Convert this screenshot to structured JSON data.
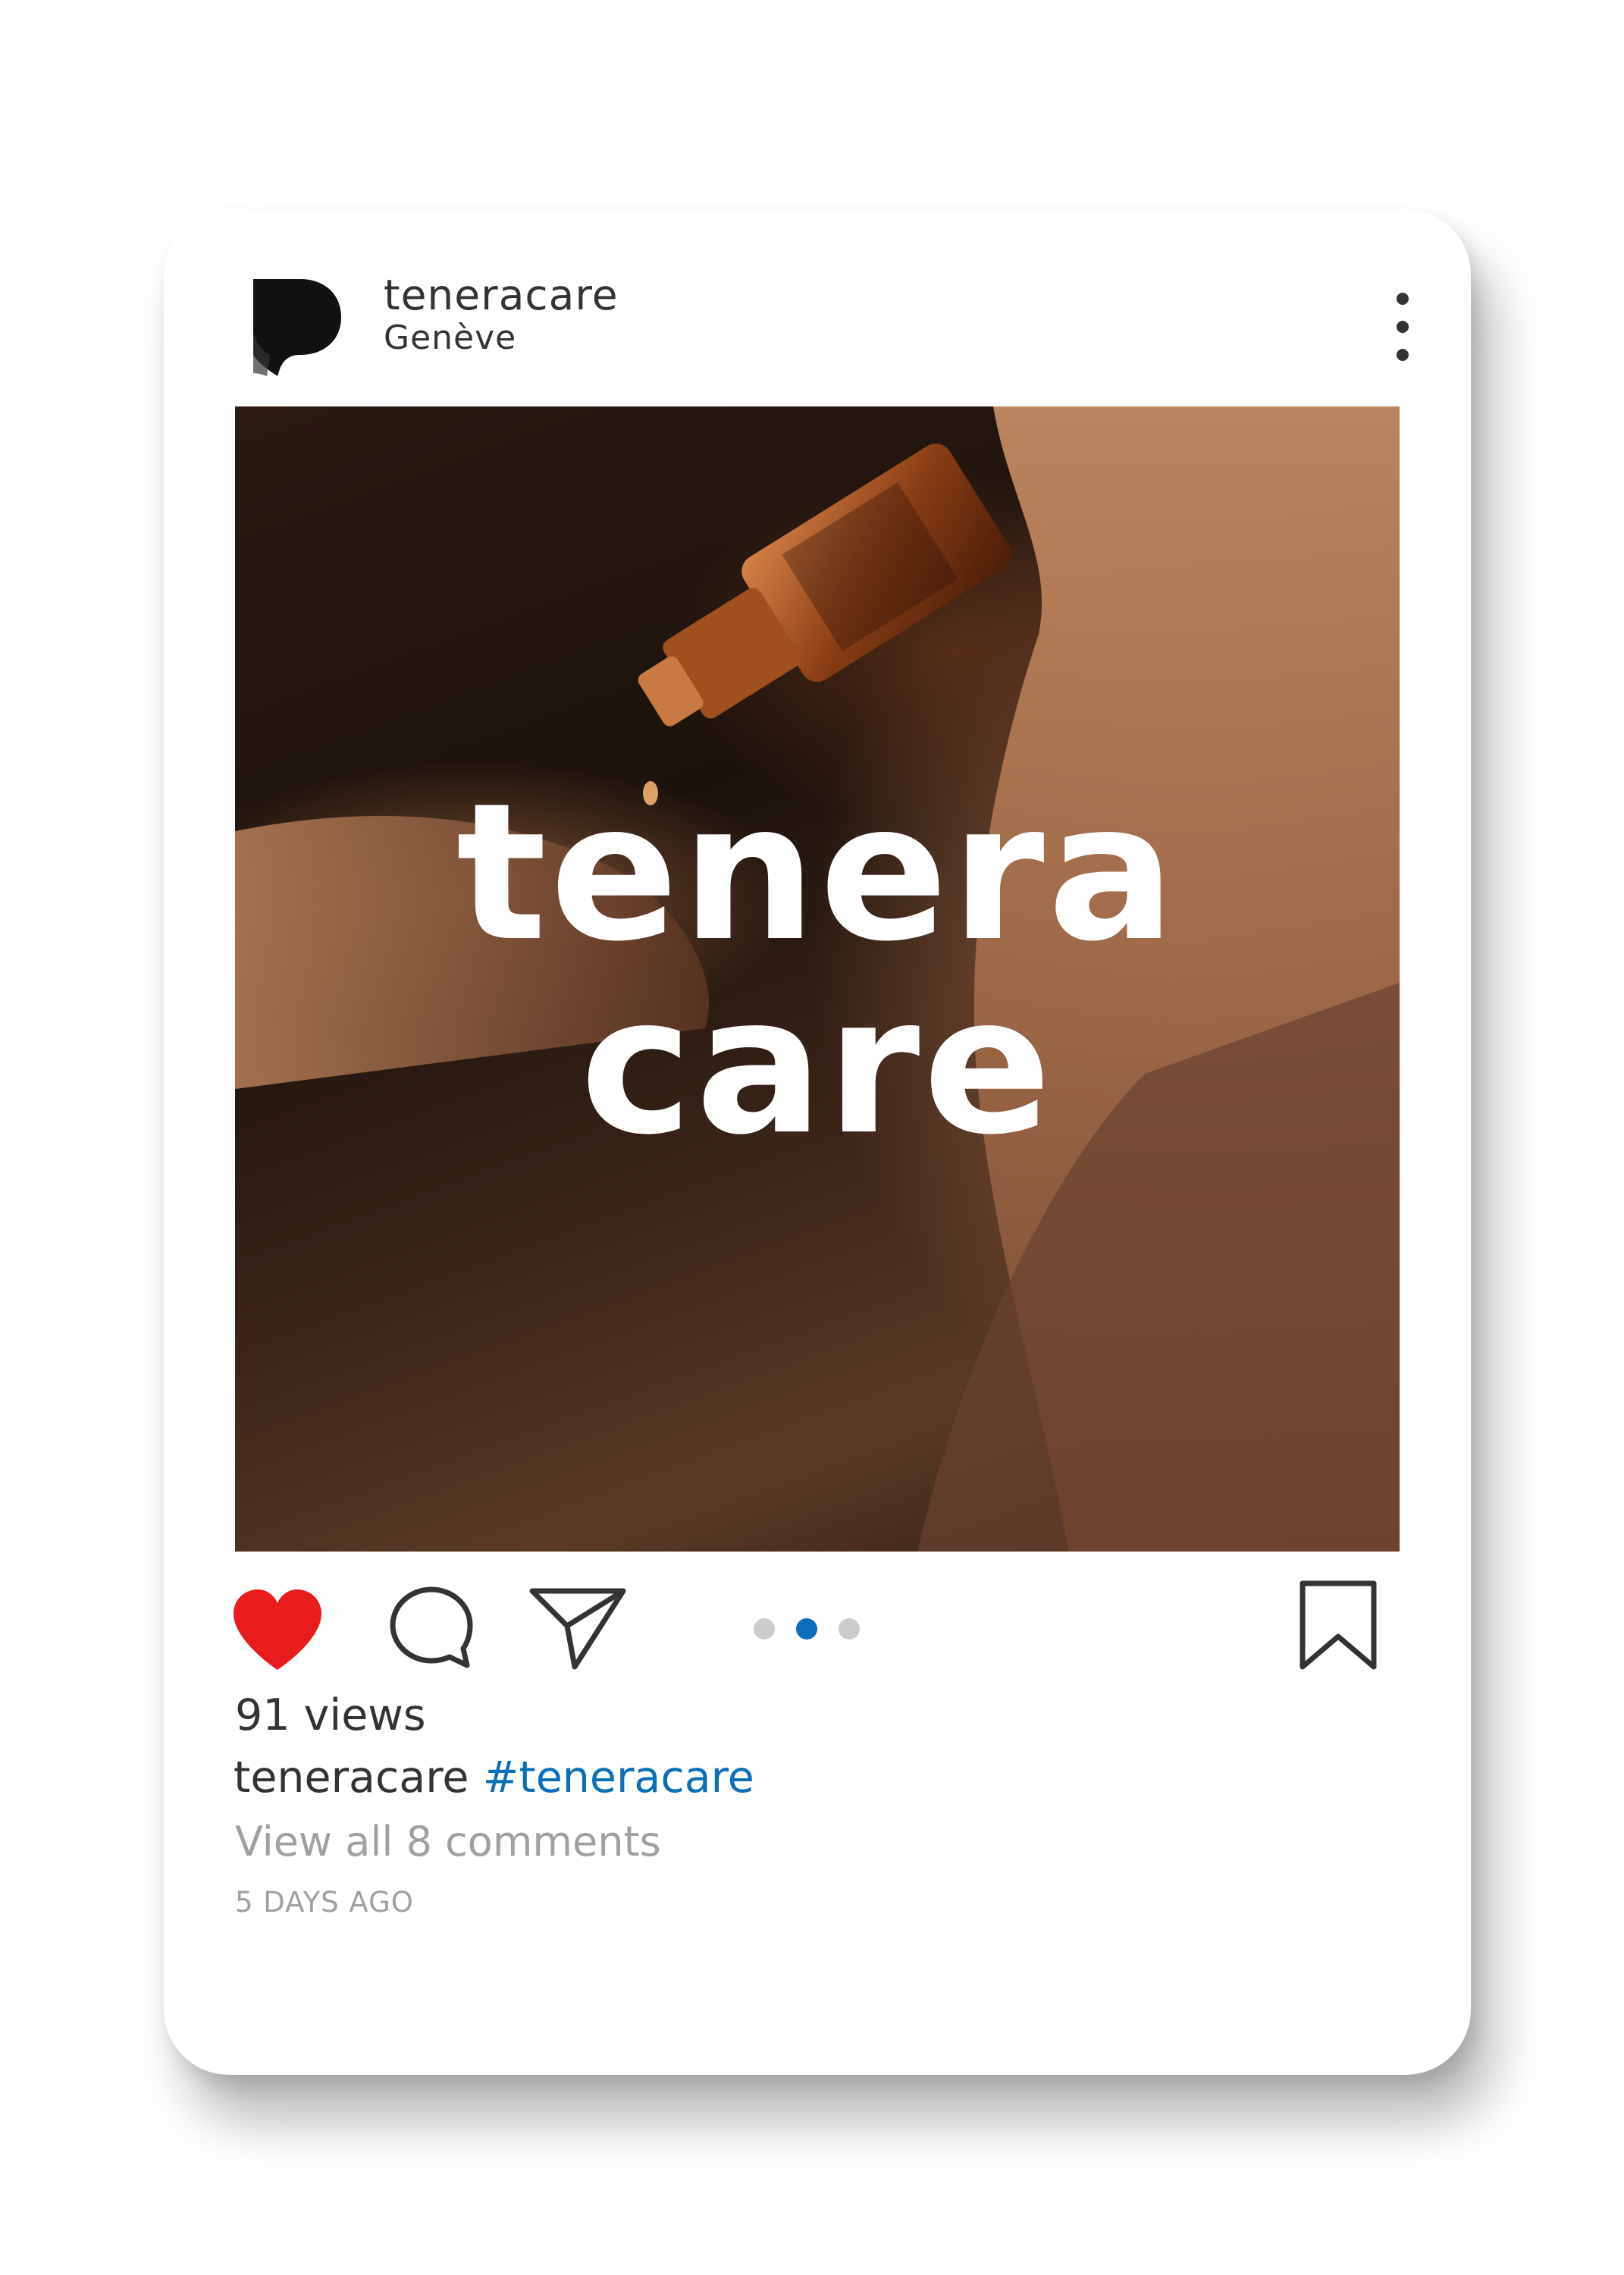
{
  "post": {
    "username": "teneracare",
    "location": "Genève",
    "image": {
      "logo_line1": "tenera",
      "logo_line2": "care",
      "subject": "essential-oil-bottle-dropper"
    },
    "carousel": {
      "total": 3,
      "active_index": 2
    },
    "views": "91 views",
    "caption": {
      "author": "teneracare",
      "hashtag": "#teneracare"
    },
    "comments_link": "View all 8 comments",
    "timestamp": "5 DAYS AGO"
  },
  "icons": {
    "avatar": "brand-logo-icon",
    "more": "more-vertical-icon",
    "like": "heart-icon",
    "comment": "comment-icon",
    "share": "send-icon",
    "save": "bookmark-icon"
  },
  "colors": {
    "like_active": "#e81c1c",
    "link": "#0a6fb8",
    "text": "#333333",
    "muted": "#a0a0a0"
  }
}
